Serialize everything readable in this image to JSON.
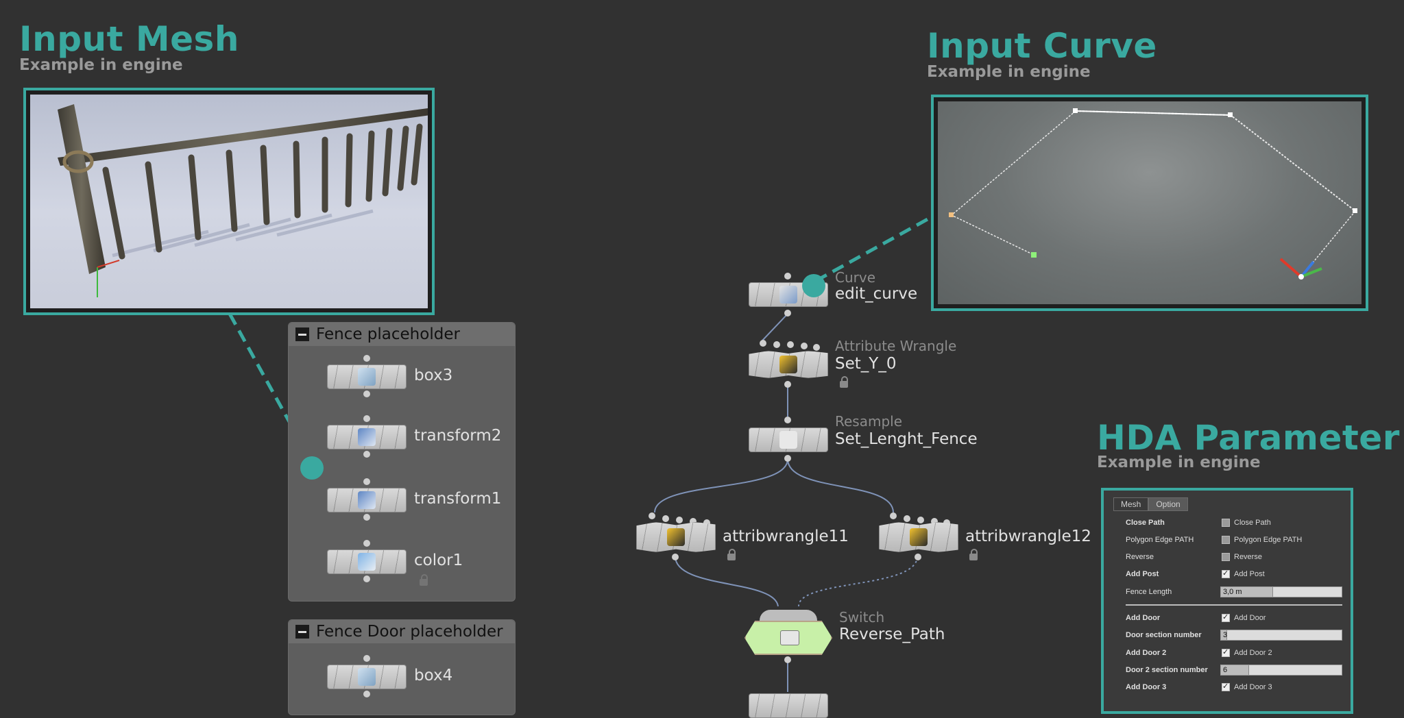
{
  "sections": {
    "input_mesh": {
      "title": "Input Mesh",
      "subtitle": "Example in engine"
    },
    "input_curve": {
      "title": "Input Curve",
      "subtitle": "Example in engine"
    },
    "hda_parameter": {
      "title": "HDA Parameter",
      "subtitle": "Example in engine"
    }
  },
  "accent_color": "#3aa9a0",
  "netboxes": {
    "fence": {
      "title": "Fence placeholder",
      "nodes": [
        "box3",
        "transform2",
        "transform1",
        "color1"
      ]
    },
    "door": {
      "title": "Fence Door placeholder",
      "nodes": [
        "box4"
      ]
    }
  },
  "nodes": {
    "curve": {
      "type": "Curve",
      "name": "edit_curve"
    },
    "setY": {
      "type": "Attribute Wrangle",
      "name": "Set_Y_0"
    },
    "resample": {
      "type": "Resample",
      "name": "Set_Lenght_Fence"
    },
    "aw11": {
      "name": "attribwrangle11"
    },
    "aw12": {
      "name": "attribwrangle12"
    },
    "switch": {
      "type": "Switch",
      "name": "Reverse_Path"
    }
  },
  "hda": {
    "tabs": [
      "Mesh",
      "Option"
    ],
    "params": [
      {
        "label": "Close Path",
        "kind": "checkbox",
        "checked": false,
        "text": "Close Path"
      },
      {
        "label": "Polygon Edge PATH",
        "kind": "checkbox",
        "checked": false,
        "text": "Polygon Edge PATH"
      },
      {
        "label": "Reverse",
        "kind": "checkbox",
        "checked": false,
        "text": "Reverse"
      },
      {
        "label": "Add Post",
        "kind": "checkbox",
        "checked": true,
        "text": "Add Post"
      },
      {
        "label": "Fence Length",
        "kind": "slider",
        "value": "3,0 m"
      },
      {
        "label": "Add Door",
        "kind": "checkbox",
        "checked": true,
        "text": "Add Door"
      },
      {
        "label": "Door section number",
        "kind": "slider",
        "value": "3"
      },
      {
        "label": "Add Door 2",
        "kind": "checkbox",
        "checked": true,
        "text": "Add Door 2"
      },
      {
        "label": "Door 2 section number",
        "kind": "slider",
        "value": "6"
      },
      {
        "label": "Add Door 3",
        "kind": "checkbox",
        "checked": true,
        "text": "Add Door 3"
      }
    ]
  }
}
